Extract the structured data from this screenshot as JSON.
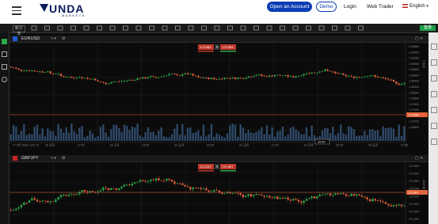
{
  "nav": {
    "logo_text": "UNDA",
    "logo_sub": "MARKETS",
    "open_account": "Open an Account",
    "demo": "Demo",
    "login": "Login",
    "web_trader": "Web Trader",
    "language": "English",
    "language_caret": "▾"
  },
  "toolbar": {
    "first_btn": "新订单",
    "right_btn": "登录",
    "icons": [
      "candles-icon",
      "bar-chart-icon",
      "chart-type-icon",
      "indicator-icon",
      "cursor-icon",
      "crosshair-icon",
      "line-icon",
      "fib-icon",
      "text-icon",
      "magnet-icon",
      "zoom-in-icon",
      "zoom-out-icon",
      "eye-icon",
      "layout-icon",
      "lock-icon",
      "template-icon",
      "grid-icon",
      "screenshot-icon",
      "trend-icon",
      "channel-icon",
      "arrow-icon",
      "measure-icon",
      "brush-icon",
      "shapes-icon",
      "pattern-icon",
      "settings-icon"
    ]
  },
  "chart1": {
    "symbol": "EURUSD",
    "bid": "1.07383",
    "ask": "1.07383",
    "current": "1.07383",
    "price_labels": [
      "1.09600",
      "1.09400",
      "1.09200",
      "1.09000",
      "1.08800",
      "1.08600",
      "1.08400",
      "1.08200",
      "1.08000",
      "1.07800",
      "1.07600",
      "1.07400",
      "1.07200",
      "1.07000",
      "1.06800"
    ],
    "time_labels": [
      "17 5月 2023, UTC+8",
      "18 五月",
      "17:00",
      "18 五月",
      "23:00",
      "22 五月",
      "09:00",
      "23 五月",
      "17:00",
      "24 五月",
      "02:00",
      "25 五月",
      "17:00"
    ],
    "cursor_time": "10:00",
    "axis_label_top": "5 五月"
  },
  "chart2": {
    "symbol": "GBPJPY",
    "bid": "172.297",
    "ask": "171.907",
    "current": "171.907",
    "price_labels": [
      "172.800",
      "172.600",
      "172.400",
      "172.200",
      "172.000",
      "171.800",
      "171.600",
      "171.400"
    ],
    "axis_label_top": "2023 年 5 月"
  },
  "colors": {
    "bull": "#2ca84a",
    "bear": "#e8633a",
    "accent": "#0a3db3",
    "price_line": "#e8633a",
    "volume": "#2f4a6a"
  }
}
